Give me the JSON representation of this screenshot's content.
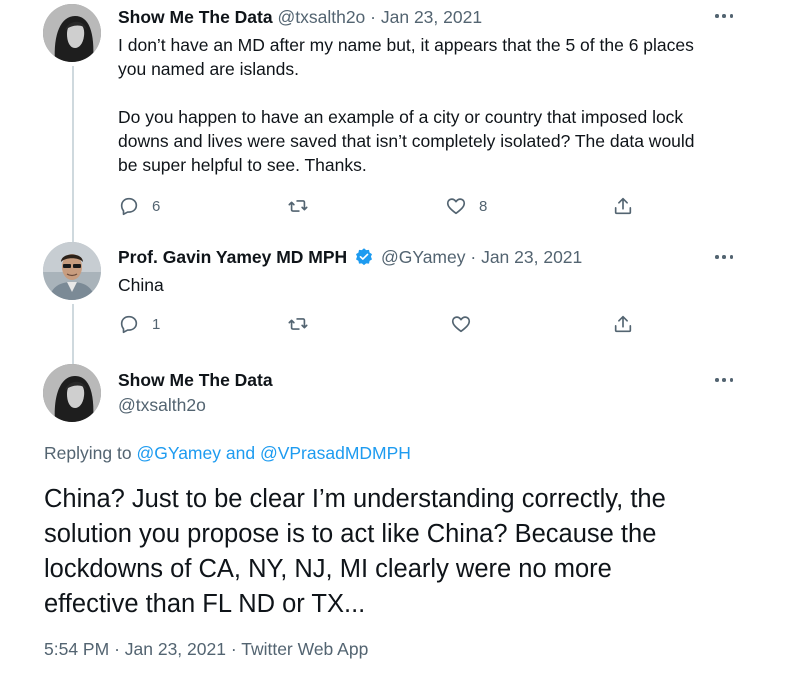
{
  "tweets": [
    {
      "display_name": "Show Me The Data",
      "handle": "@txsalth2o",
      "separator": "·",
      "date": "Jan 23, 2021",
      "text_lines": [
        "I don’t have an MD after my name but, it appears that the 5 of the 6 places",
        "you named are islands.",
        "",
        "Do you happen to have an example of a city or country that imposed lock",
        "downs and lives were saved that isn’t completely isolated? The data would",
        "be super helpful to see. Thanks."
      ],
      "reply_count": "6",
      "retweet_count": "",
      "like_count": "8"
    },
    {
      "display_name": "Prof. Gavin Yamey MD MPH",
      "handle": "@GYamey",
      "separator": "·",
      "date": "Jan 23, 2021",
      "text": "China",
      "verified": true,
      "reply_count": "1",
      "retweet_count": "",
      "like_count": ""
    }
  ],
  "main_tweet": {
    "display_name": "Show Me The Data",
    "handle": "@txsalth2o",
    "replying_prefix": "Replying to",
    "replying_mention_1": "@GYamey",
    "replying_and": "and",
    "replying_mention_2": "@VPrasadMDMPH",
    "text_lines": [
      "China? Just to be clear I’m understanding correctly, the",
      "solution you propose is to act like China? Because the",
      "lockdowns of CA, NY, NJ, MI clearly were no more",
      "effective than FL ND or TX..."
    ],
    "time": "5:54 PM",
    "separator_1": "·",
    "date": "Jan 23, 2021",
    "separator_2": "·",
    "source": "Twitter Web App"
  },
  "colors": {
    "text": "#0f1419",
    "secondary": "#536471",
    "link": "#1d9bf0",
    "thread_line": "#cfd9de",
    "verified": "#1d9bf0"
  },
  "icons": {
    "reply": "reply-icon",
    "retweet": "retweet-icon",
    "like": "heart-icon",
    "share": "share-icon",
    "more": "more-icon",
    "verified": "verified-badge-icon"
  }
}
